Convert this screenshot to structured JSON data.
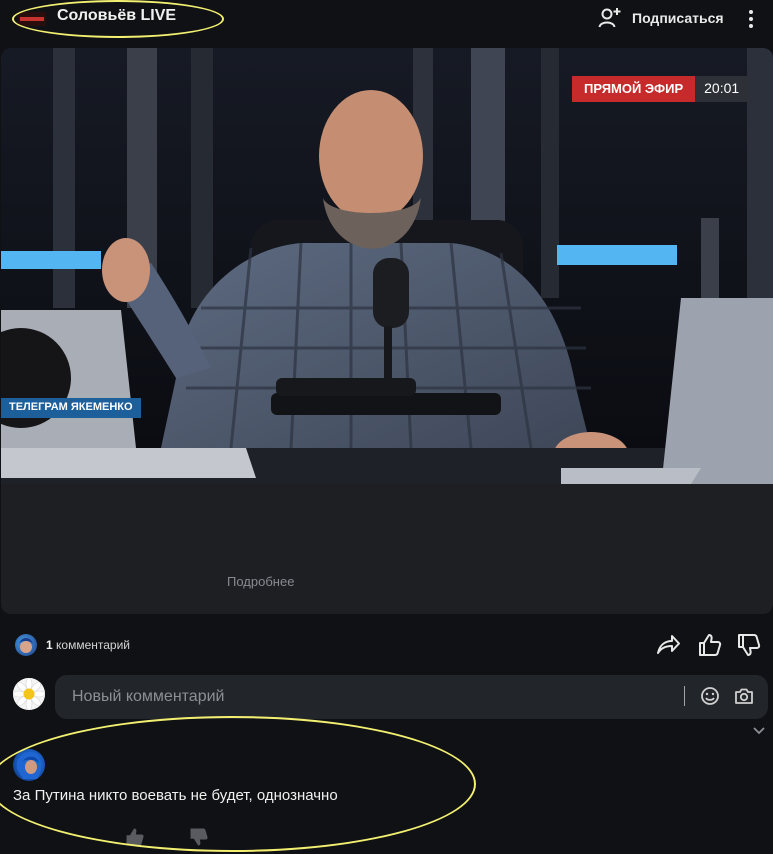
{
  "channel": {
    "name": "Соловьёв LIVE",
    "subscribe_label": "Подписаться"
  },
  "video": {
    "live_badge": "ПРЯМОЙ ЭФИР",
    "live_time": "20:01",
    "ticker_text": "ТЕЛЕГРАМ ЯКЕМЕНКО",
    "more_label": "Подробнее"
  },
  "actions": {
    "comment_count": "1",
    "comment_count_label": "комментарий",
    "icons": [
      "share-icon",
      "like-icon",
      "dislike-icon"
    ]
  },
  "comment_input": {
    "placeholder": "Новый комментарий",
    "icons": [
      "emoji-icon",
      "camera-icon"
    ]
  },
  "comments": [
    {
      "text": "За Путина никто воевать не будет, однозначно"
    }
  ],
  "colors": {
    "background": "#101114",
    "card": "#1d1f23",
    "live_red": "#c72a2a",
    "annotation": "#f3f071"
  }
}
